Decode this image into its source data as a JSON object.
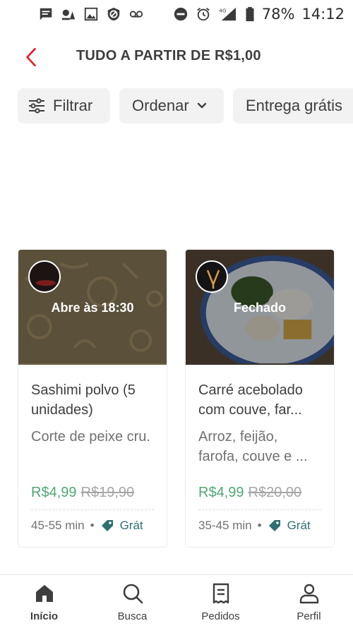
{
  "status_bar": {
    "battery": "78%",
    "time": "14:12",
    "network": "4G"
  },
  "header": {
    "title": "TUDO A PARTIR DE R$1,00"
  },
  "filters": [
    {
      "label": "Filtrar"
    },
    {
      "label": "Ordenar"
    },
    {
      "label": "Entrega grátis"
    }
  ],
  "cards": [
    {
      "status": "Abre às 18:30",
      "name": "Sashimi polvo (5 unidades)",
      "description": "Corte de peixe cru.",
      "price": "R$4,99",
      "old_price": "R$19,90",
      "time": "45-55 min",
      "delivery": "Grát"
    },
    {
      "status": "Fechado",
      "name": "Carré acebolado com couve, far...",
      "description": "Arroz, feijão, farofa, couve e ...",
      "price": "R$4,99",
      "old_price": "R$20,00",
      "time": "35-45 min",
      "delivery": "Grát"
    }
  ],
  "bottom_nav": [
    {
      "label": "Início",
      "icon": "home-icon",
      "active": true
    },
    {
      "label": "Busca",
      "icon": "search-icon"
    },
    {
      "label": "Pedidos",
      "icon": "orders-icon"
    },
    {
      "label": "Perfil",
      "icon": "profile-icon"
    }
  ],
  "colors": {
    "accent": "#ea1d2c",
    "price": "#50a773",
    "free": "#2e6f71"
  }
}
